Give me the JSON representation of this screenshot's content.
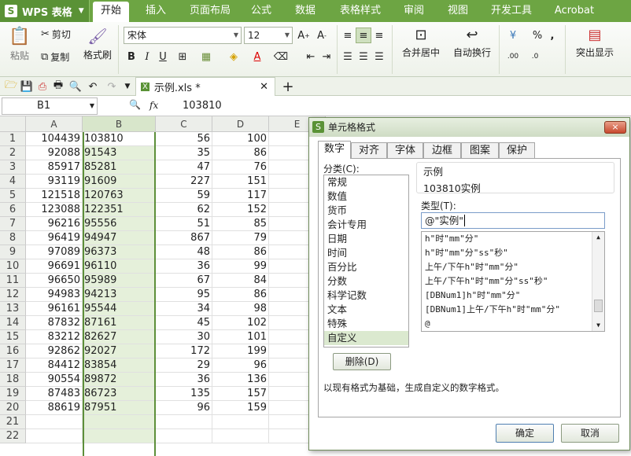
{
  "app": {
    "logo_letter": "S",
    "name": "WPS 表格"
  },
  "menu_tabs": [
    "开始",
    "插入",
    "页面布局",
    "公式",
    "数据",
    "表格样式",
    "审阅",
    "视图",
    "开发工具",
    "Acrobat"
  ],
  "ribbon": {
    "paste": "粘贴",
    "cut": "剪切",
    "copy": "复制",
    "format_painter": "格式刷",
    "font_name": "宋体",
    "font_size": "12",
    "merge_center": "合并居中",
    "wrap_text": "自动换行",
    "highlight": "突出显示",
    "percent": "%",
    "comma": ","
  },
  "document_tab": {
    "name": "示例.xls *"
  },
  "formula_bar": {
    "cell_ref": "B1",
    "fx": "fx",
    "value": "103810"
  },
  "columns": [
    "A",
    "B",
    "C",
    "D",
    "E"
  ],
  "rows": [
    {
      "n": "1",
      "a": "104439",
      "b": "103810",
      "c": "56",
      "d": "100"
    },
    {
      "n": "2",
      "a": "92088",
      "b": "91543",
      "c": "35",
      "d": "86"
    },
    {
      "n": "3",
      "a": "85917",
      "b": "85281",
      "c": "47",
      "d": "76"
    },
    {
      "n": "4",
      "a": "93119",
      "b": "91609",
      "c": "227",
      "d": "151"
    },
    {
      "n": "5",
      "a": "121518",
      "b": "120763",
      "c": "59",
      "d": "117"
    },
    {
      "n": "6",
      "a": "123088",
      "b": "122351",
      "c": "62",
      "d": "152"
    },
    {
      "n": "7",
      "a": "96216",
      "b": "95556",
      "c": "51",
      "d": "85"
    },
    {
      "n": "8",
      "a": "96419",
      "b": "94947",
      "c": "867",
      "d": "79"
    },
    {
      "n": "9",
      "a": "97089",
      "b": "96373",
      "c": "48",
      "d": "86"
    },
    {
      "n": "10",
      "a": "96691",
      "b": "96110",
      "c": "36",
      "d": "99"
    },
    {
      "n": "11",
      "a": "96650",
      "b": "95989",
      "c": "67",
      "d": "84"
    },
    {
      "n": "12",
      "a": "94983",
      "b": "94213",
      "c": "95",
      "d": "86"
    },
    {
      "n": "13",
      "a": "96161",
      "b": "95544",
      "c": "34",
      "d": "98"
    },
    {
      "n": "14",
      "a": "87832",
      "b": "87161",
      "c": "45",
      "d": "102"
    },
    {
      "n": "15",
      "a": "83212",
      "b": "82627",
      "c": "30",
      "d": "101"
    },
    {
      "n": "16",
      "a": "92862",
      "b": "92027",
      "c": "172",
      "d": "199"
    },
    {
      "n": "17",
      "a": "84412",
      "b": "83854",
      "c": "29",
      "d": "96"
    },
    {
      "n": "18",
      "a": "90554",
      "b": "89872",
      "c": "36",
      "d": "136"
    },
    {
      "n": "19",
      "a": "87483",
      "b": "86723",
      "c": "135",
      "d": "157"
    },
    {
      "n": "20",
      "a": "88619",
      "b": "87951",
      "c": "96",
      "d": "159"
    },
    {
      "n": "21",
      "a": "",
      "b": "",
      "c": "",
      "d": ""
    },
    {
      "n": "22",
      "a": "",
      "b": "",
      "c": "",
      "d": ""
    }
  ],
  "dialog": {
    "logo_letter": "S",
    "title": "单元格格式",
    "close": "×",
    "tabs": [
      "数字",
      "对齐",
      "字体",
      "边框",
      "图案",
      "保护"
    ],
    "category_label": "分类(C):",
    "categories": [
      "常规",
      "数值",
      "货币",
      "会计专用",
      "日期",
      "时间",
      "百分比",
      "分数",
      "科学记数",
      "文本",
      "特殊",
      "自定义"
    ],
    "selected_category": "自定义",
    "sample_label": "示例",
    "sample_value": "103810实例",
    "type_label": "类型(T):",
    "type_value": "@\"实例\"",
    "type_list": [
      "h\"时\"mm\"分\"",
      "h\"时\"mm\"分\"ss\"秒\"",
      "上午/下午h\"时\"mm\"分\"",
      "上午/下午h\"时\"mm\"分\"ss\"秒\"",
      "[DBNum1]h\"时\"mm\"分\"",
      "[DBNum1]上午/下午h\"时\"mm\"分\"",
      "@"
    ],
    "delete_button": "删除(D)",
    "description": "以现有格式为基础，生成自定义的数字格式。",
    "ok_button": "确定",
    "cancel_button": "取消"
  }
}
